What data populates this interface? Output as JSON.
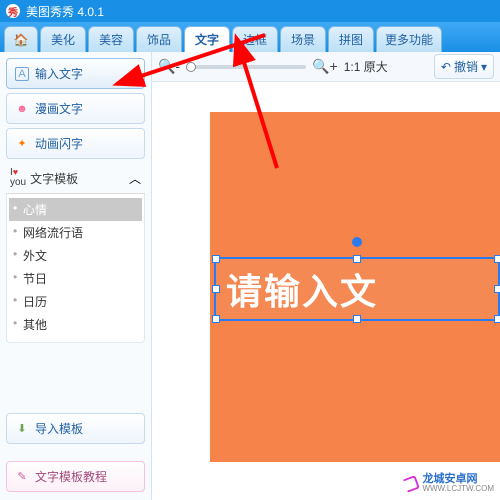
{
  "title": "美图秀秀 4.0.1",
  "tabs": {
    "beautify": "美化",
    "portrait": "美容",
    "decor": "饰品",
    "text": "文字",
    "frame": "边框",
    "scene": "场景",
    "collage": "拼图",
    "more": "更多功能"
  },
  "sidebar": {
    "input_text": "输入文字",
    "comic_text": "漫画文字",
    "anim_text": "动画闪字",
    "template_header": "文字模板",
    "tree": {
      "mood": "心情",
      "net_slang": "网络流行语",
      "foreign": "外文",
      "festival": "节日",
      "calendar": "日历",
      "other": "其他"
    },
    "import": "导入模板",
    "tutorial": "文字模板教程"
  },
  "toolbar": {
    "ratio_label": "1:1 原大",
    "undo": "撤销"
  },
  "canvas": {
    "placeholder_text": "请输入文"
  },
  "watermark": "龙城安卓网",
  "watermark_url": "WWW.LCJTW.COM"
}
